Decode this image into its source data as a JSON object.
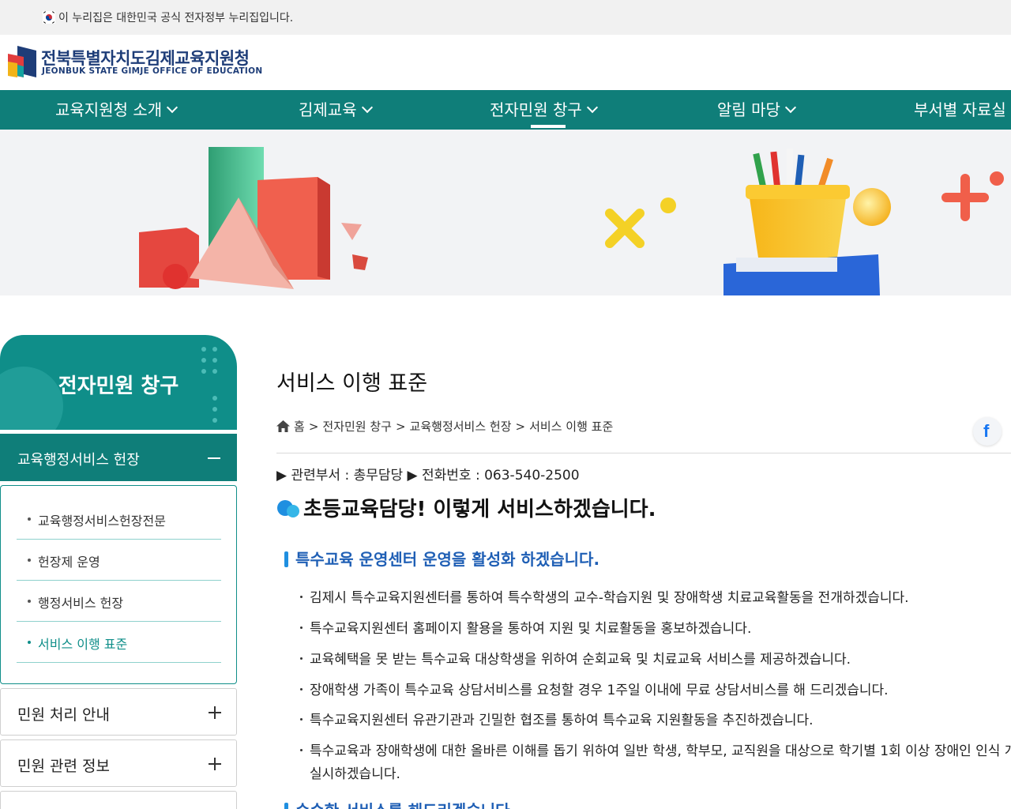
{
  "gov_banner": {
    "text": "이 누리집은 대한민국 공식 전자정부 누리집입니다."
  },
  "logo": {
    "name_ko": "전북특별자치도김제교육지원청",
    "name_en": "JEONBUK STATE GIMJE OFFICE OF EDUCATION"
  },
  "gnb": {
    "items": [
      {
        "label": "교육지원청 소개"
      },
      {
        "label": "김제교육"
      },
      {
        "label": "전자민원 창구"
      },
      {
        "label": "알림 마당"
      },
      {
        "label": "부서별 자료실"
      }
    ],
    "active_index": 2
  },
  "sidebar": {
    "title": "전자민원 창구",
    "open_group": "교육행정서비스 헌장",
    "sub_items": [
      "교육행정서비스헌장전문",
      "헌장제 운영",
      "행정서비스 헌장",
      "서비스 이행 표준"
    ],
    "active_sub": "서비스 이행 표준",
    "groups": [
      "민원 처리 안내",
      "민원 관련 정보"
    ]
  },
  "content": {
    "page_title": "서비스 이행 표준",
    "breadcrumb": [
      "홈",
      "전자민원 창구",
      "교육행정서비스 헌장",
      "서비스 이행 표준"
    ],
    "breadcrumb_sep": ">",
    "share_facebook": "f",
    "dept_line": "▶ 관련부서 : 총무담당 ▶ 전화번호 : 063-540-2500",
    "main_heading": "초등교육담당! 이렇게 서비스하겠습니다.",
    "section1_title": "특수교육 운영센터 운영을 활성화 하겠습니다.",
    "section1_bullets": [
      "김제시 특수교육지원센터를 통하여 특수학생의 교수-학습지원 및 장애학생 치료교육활동을 전개하겠습니다.",
      "특수교육지원센터 홈페이지 활용을 통하여 지원 및 치료활동을 홍보하겠습니다.",
      "교육혜택을 못 받는 특수교육 대상학생을 위하여 순회교육 및 치료교육 서비스를 제공하겠습니다.",
      "장애학생 가족이 특수교육 상담서비스를 요청할 경우 1주일 이내에 무료 상담서비스를 해 드리겠습니다.",
      "특수교육지원센터 유관기관과 긴밀한 협조를 통하여 특수교육 지원활동을 추진하겠습니다.",
      "특수교육과 장애학생에 대한 올바른 이해를 돕기 위하여 일반 학생, 학부모, 교직원을 대상으로 학기별 1회 이상 장애인 인식 개선"
    ],
    "section1_bullet6_cont": "실시하겠습니다.",
    "section2_title": "순순한 서비스를 해드리겠습니다"
  },
  "colors": {
    "primary": "#0f7e79",
    "sidebar_head": "#0f8e89",
    "heading_blue": "#1f5fb5",
    "logo_navy": "#1e3d78"
  }
}
